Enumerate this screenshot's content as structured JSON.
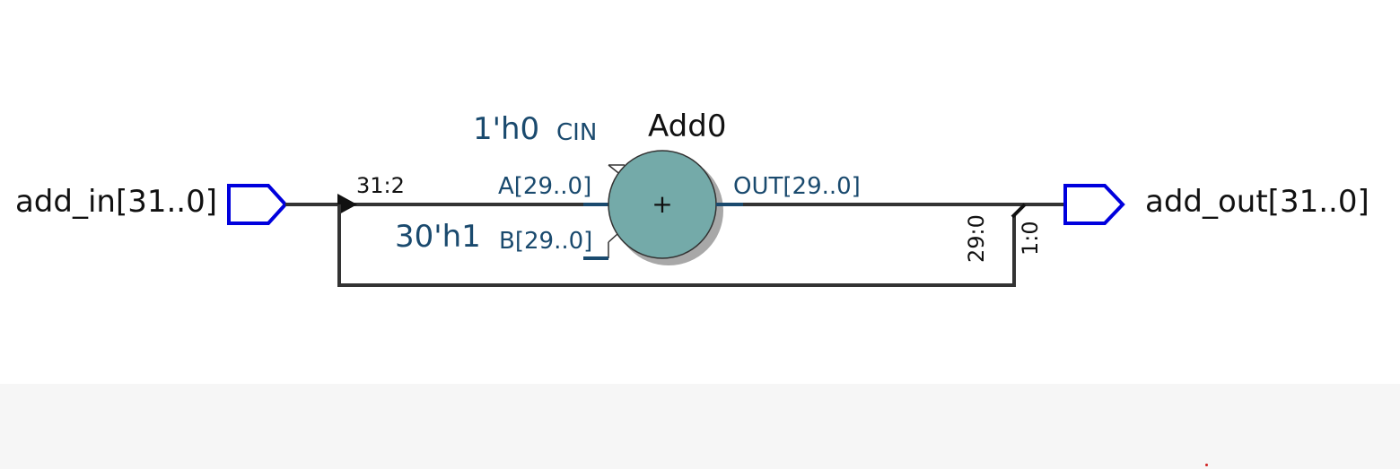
{
  "diagram": {
    "input_port": {
      "label": "add_in[31..0]"
    },
    "output_port": {
      "label": "add_out[31..0]"
    },
    "adder": {
      "instance": "Add0",
      "operator": "+",
      "pins": {
        "cin": "CIN",
        "a": "A[29..0]",
        "b": "B[29..0]",
        "out": "OUT[29..0]"
      },
      "constants": {
        "cin": "1'h0",
        "b": "30'h1"
      }
    },
    "bus_slices": {
      "input_tap": "31:2",
      "out_low": "29:0",
      "out_high": "1:0"
    }
  },
  "colors": {
    "wire": "#333333",
    "port": "#0000dd",
    "adder_fill": "#74aaa9",
    "adder_shadow": "#a8a8a8",
    "pin": "#1a4a6e",
    "footer": "#f6f6f6"
  }
}
